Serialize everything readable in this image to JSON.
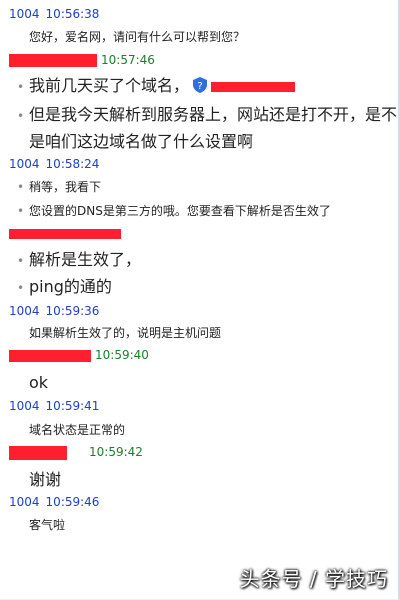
{
  "messages": [
    {
      "from": "1004",
      "time": "10:56:38",
      "lines": [
        "您好，爱名网，请问有什么可以帮到您？"
      ]
    },
    {
      "time": "10:57:46",
      "lines": [
        "我前几天买了个域名，",
        "但是我今天解析到服务器上，网站还是打不开，是不",
        "是咱们这边域名做了什么设置啊"
      ]
    },
    {
      "from": "1004",
      "time": "10:58:24",
      "lines": [
        "稍等，我看下",
        "您设置的DNS是第三方的哦。您要查看下解析是否生效了"
      ]
    },
    {
      "lines": [
        "解析是生效了，",
        "ping的通的"
      ]
    },
    {
      "from": "1004",
      "time": "10:59:36",
      "lines": [
        "如果解析生效了的，说明是主机问题"
      ]
    },
    {
      "time": "10:59:40",
      "lines": [
        "ok"
      ]
    },
    {
      "from": "1004",
      "time": "10:59:41",
      "lines": [
        "域名状态是正常的"
      ]
    },
    {
      "time": "10:59:42",
      "lines": [
        "谢谢"
      ]
    },
    {
      "from": "1004",
      "time": "10:59:46",
      "lines": [
        "客气啦"
      ]
    }
  ],
  "colors": {
    "agent_header": "#1f40c8",
    "customer_time": "#1a7f2e",
    "redaction": "#ff1f2f"
  },
  "watermark": "头条号 / 学技巧",
  "icons": {
    "shield": "shield-icon"
  }
}
